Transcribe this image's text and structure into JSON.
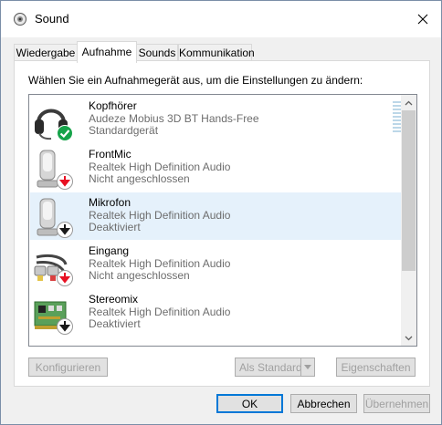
{
  "window": {
    "title": "Sound"
  },
  "tabs": [
    {
      "label": "Wiedergabe"
    },
    {
      "label": "Aufnahme"
    },
    {
      "label": "Sounds"
    },
    {
      "label": "Kommunikation"
    }
  ],
  "instructions": "Wählen Sie ein Aufnahmegerät aus, um die Einstellungen zu ändern:",
  "devices": [
    {
      "name": "Kopfhörer",
      "description": "Audeze Mobius 3D BT Hands-Free",
      "status": "Standardgerät",
      "icon": "headset-icon",
      "badge": "default-check-badge"
    },
    {
      "name": "FrontMic",
      "description": "Realtek High Definition Audio",
      "status": "Nicht angeschlossen",
      "icon": "microphone-icon",
      "badge": "unplugged-badge"
    },
    {
      "name": "Mikrofon",
      "description": "Realtek High Definition Audio",
      "status": "Deaktiviert",
      "icon": "microphone-icon",
      "badge": "disabled-badge"
    },
    {
      "name": "Eingang",
      "description": "Realtek High Definition Audio",
      "status": "Nicht angeschlossen",
      "icon": "rca-cable-icon",
      "badge": "unplugged-badge"
    },
    {
      "name": "Stereomix",
      "description": "Realtek High Definition Audio",
      "status": "Deaktiviert",
      "icon": "sound-card-icon",
      "badge": "disabled-badge"
    }
  ],
  "buttons": {
    "configure": "Konfigurieren",
    "set_default": "Als Standard",
    "properties": "Eigenschaften",
    "ok": "OK",
    "cancel": "Abbrechen",
    "apply": "Übernehmen"
  },
  "colors": {
    "accent": "#0078d7",
    "selection": "#e5f1fb",
    "check_green": "#16a34a",
    "unplugged_red": "#e81123",
    "disabled_black": "#1a1a1a"
  }
}
